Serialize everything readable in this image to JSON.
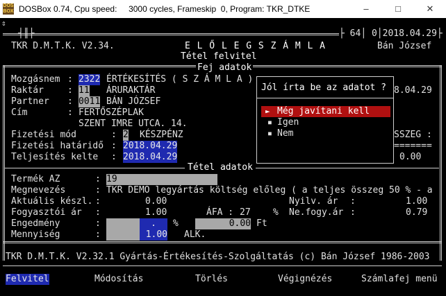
{
  "window": {
    "title": "DOSBox 0.74, Cpu speed:     3000 cycles, Frameskip  0, Program: TKR_DTKE",
    "icon_label": "DOS BOX"
  },
  "header": {
    "left_badge": "┤║├",
    "right_badge_num": "64",
    "right_badge_zero": "0",
    "date": "2018.04.29",
    "app_version": "TKR D.M.T.K. V2.34.",
    "doc_title": "E L Ő L E G S Z Á M L A",
    "user": "Bán József",
    "subtitle": "Tétel felvitel",
    "section_head": "Fej adatok",
    "items_head": "Tétel adatok"
  },
  "head_fields": [
    {
      "label": "Mozgásnem",
      "code": "2322",
      "value": "ÉRTÉKESÍTÉS ( S Z Á M L A )"
    },
    {
      "label": "Raktár",
      "code": "11",
      "value": "ÁRURAKTÁR"
    },
    {
      "label": "Partner",
      "code": "0011",
      "value": "BÁN JÓZSEF"
    },
    {
      "label": "Cím",
      "code": "",
      "value": "FERTŐSZÉPLAK"
    },
    {
      "label": "",
      "code": "",
      "value": "SZENT IMRE UTCA. 14."
    }
  ],
  "payment": {
    "mode_label": "Fizetési mód",
    "mode_code": "2",
    "mode_value": "KÉSZPÉNZ",
    "due_label": "Fizetési határidő",
    "due_value": "2018.04.29",
    "perf_label": "Teljesítés kelte",
    "perf_value": "2018.04.29"
  },
  "right_side": {
    "date_fragment": "8.04.29",
    "sum_label": "SSZEG :",
    "sum_sep": "=======",
    "sum_value": "0.00"
  },
  "popup": {
    "question": "Jól írta be az adatot ?",
    "options": [
      "Még javítani kell",
      "Igen",
      "Nem"
    ],
    "selected_index": 0
  },
  "item": {
    "termek_label": "Termék AZ",
    "termek_value": "19",
    "megnev_label": "Megnevezés",
    "megnev_value": "TKR DEMO legyártás költség előleg ( a teljes összeg 50 % - a",
    "akt_label": "Aktuális készl.",
    "akt_value": "0.00",
    "nyilv_label": "Nyilv. ár",
    "nyilv_value": "1.00",
    "fogy_label": "Fogyasztói ár",
    "fogy_value": "1.00",
    "afa_label": "ÁFA :",
    "afa_value": "27",
    "pct": "%",
    "nefogy_label": "Ne.fogy.ár",
    "nefogy_value": "0.79",
    "eng_label": "Engedmény",
    "eng_value": ".",
    "eng_pct": "%",
    "eng_amount": "0.00",
    "eng_ft": "Ft",
    "menny_label": "Mennyiség",
    "menny_value": "1.00",
    "menny_unit": "ALK."
  },
  "footer": {
    "copyright": "TKR D.M.T.K. V2.32.1 Gyártás-Értékesítés-Szolgáltatás (c) Bán József 1986-2003"
  },
  "fkeys": [
    "Felvitel",
    "Módosítás",
    "Törlés",
    "Végignézés",
    "Számlafej menü"
  ],
  "colors": {
    "selection_blue": "#1f2ab0",
    "popup_red": "#b01010",
    "field_gray": "#a8a8a8"
  }
}
